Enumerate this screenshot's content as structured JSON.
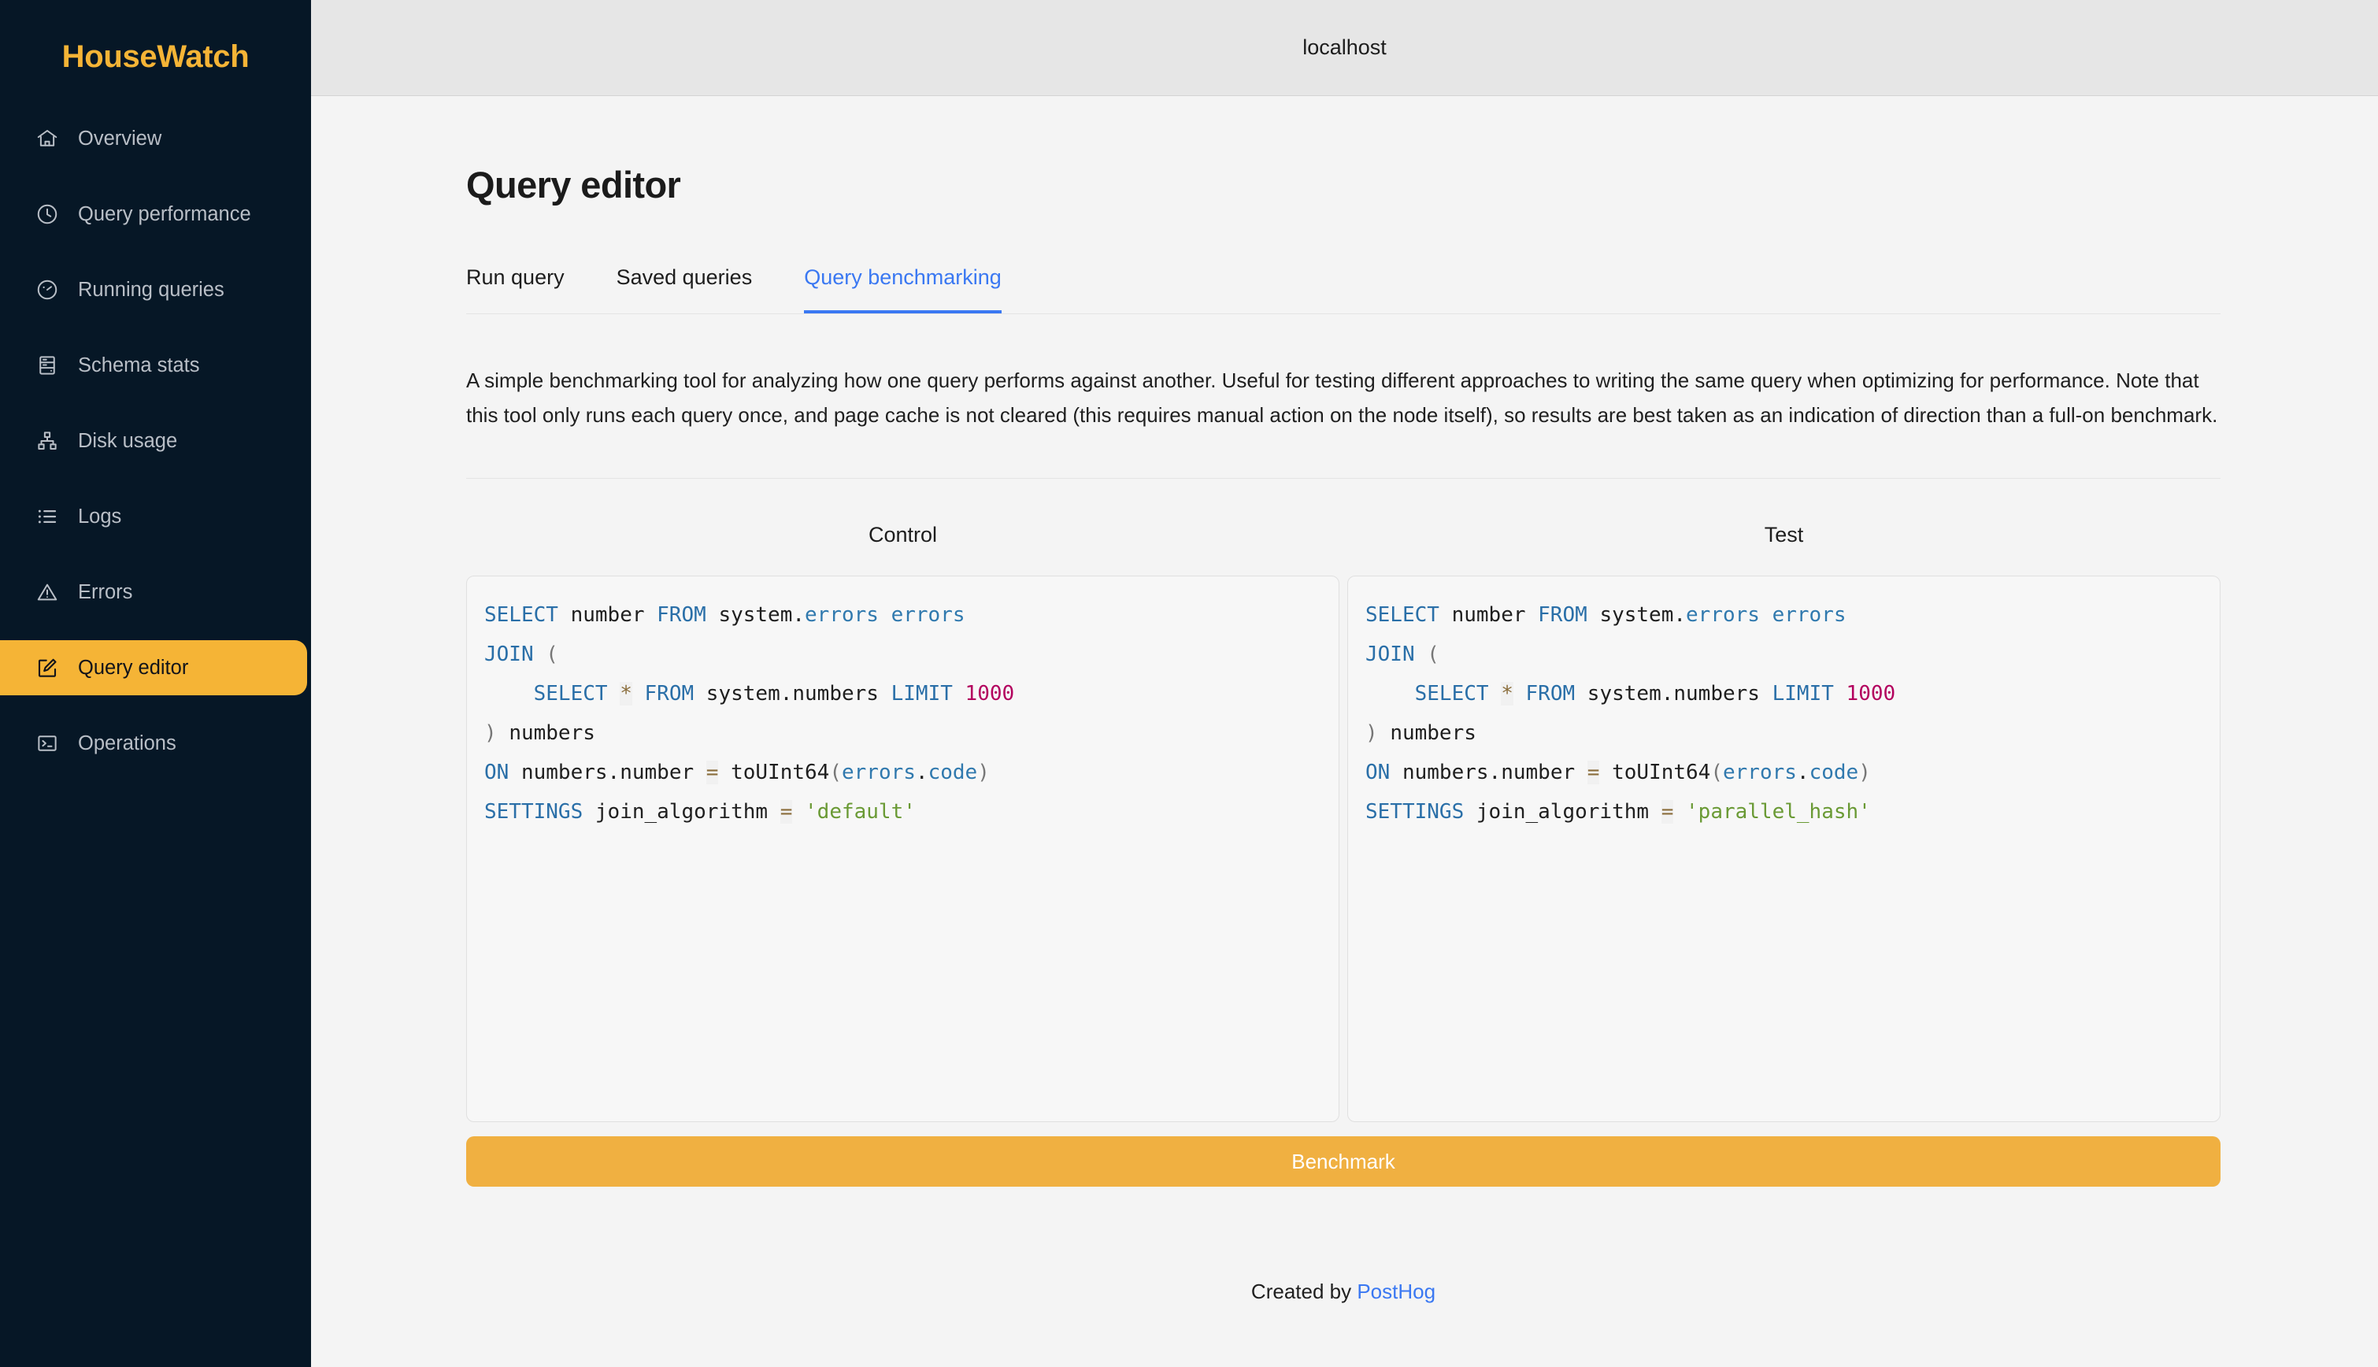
{
  "brand": {
    "name": "HouseWatch",
    "color": "#f5b436"
  },
  "sidebar": {
    "items": [
      {
        "label": "Overview",
        "icon": "home-icon",
        "active": false
      },
      {
        "label": "Query performance",
        "icon": "clock-icon",
        "active": false
      },
      {
        "label": "Running queries",
        "icon": "gauge-icon",
        "active": false
      },
      {
        "label": "Schema stats",
        "icon": "server-icon",
        "active": false
      },
      {
        "label": "Disk usage",
        "icon": "sitemap-icon",
        "active": false
      },
      {
        "label": "Logs",
        "icon": "list-icon",
        "active": false
      },
      {
        "label": "Errors",
        "icon": "warning-triangle-icon",
        "active": false
      },
      {
        "label": "Query editor",
        "icon": "edit-square-icon",
        "active": true
      },
      {
        "label": "Operations",
        "icon": "terminal-icon",
        "active": false
      }
    ]
  },
  "topbar": {
    "host": "localhost"
  },
  "page": {
    "title": "Query editor",
    "tabs": [
      {
        "label": "Run query",
        "active": false
      },
      {
        "label": "Saved queries",
        "active": false
      },
      {
        "label": "Query benchmarking",
        "active": true
      }
    ],
    "description": "A simple benchmarking tool for analyzing how one query performs against another. Useful for testing different approaches to writing the same query when optimizing for performance. Note that this tool only runs each query once, and page cache is not cleared (this requires manual action on the node itself), so results are best taken as an indication of direction than a full-on benchmark.",
    "columns": {
      "control_label": "Control",
      "test_label": "Test"
    },
    "control_query": "SELECT number FROM system.errors errors\nJOIN (\n    SELECT * FROM system.numbers LIMIT 1000\n) numbers\nON numbers.number = toUInt64(errors.code)\nSETTINGS join_algorithm = 'default'",
    "test_query": "SELECT number FROM system.errors errors\nJOIN (\n    SELECT * FROM system.numbers LIMIT 1000\n) numbers\nON numbers.number = toUInt64(errors.code)\nSETTINGS join_algorithm = 'parallel_hash'",
    "benchmark_button": "Benchmark",
    "footer_prefix": "Created by ",
    "footer_link": "PostHog"
  },
  "colors": {
    "sidebar_bg": "#061726",
    "accent": "#f5b436",
    "button": "#f0b041",
    "tab_active": "#3a78f2",
    "sql_keyword": "#2a6fa8",
    "sql_identifier": "#3079ae",
    "sql_number": "#b3005e",
    "sql_string": "#6a9a35",
    "sql_operator": "#8a6d3b"
  }
}
